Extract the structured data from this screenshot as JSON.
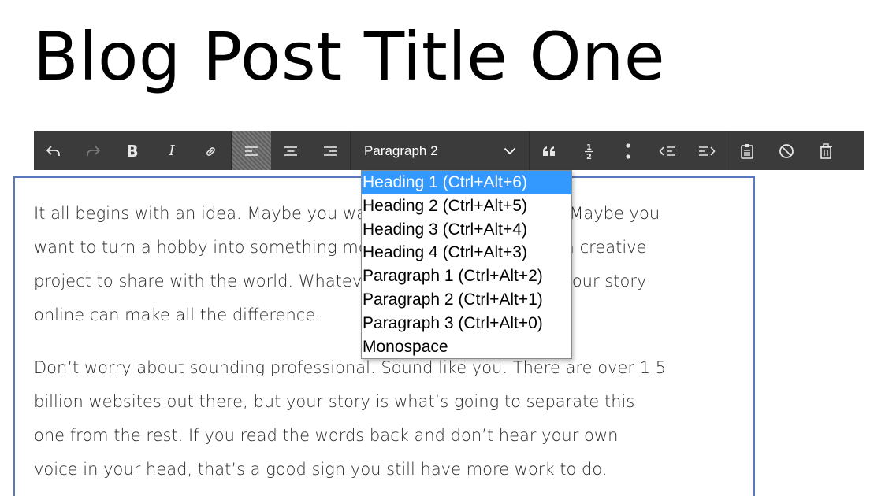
{
  "post": {
    "title": "Blog Post Title One"
  },
  "toolbar": {
    "format_value": "Paragraph 2",
    "buttons": {
      "undo": "undo-icon",
      "redo": "redo-icon",
      "bold": "B",
      "italic": "I",
      "link": "link-icon",
      "align_left": "align-left-icon",
      "align_center": "align-center-icon",
      "align_right": "align-right-icon",
      "quote": "quote-icon",
      "numbered_list": "numbered-list-icon",
      "bulleted_list": "bulleted-list-icon",
      "outdent": "outdent-icon",
      "indent": "indent-icon",
      "paste": "clipboard-icon",
      "clear_format": "clear-format-icon",
      "delete": "trash-icon"
    }
  },
  "format_dropdown": {
    "options": [
      "Heading 1 (Ctrl+Alt+6)",
      "Heading 2 (Ctrl+Alt+5)",
      "Heading 3 (Ctrl+Alt+4)",
      "Heading 4 (Ctrl+Alt+3)",
      "Paragraph 1 (Ctrl+Alt+2)",
      "Paragraph 2 (Ctrl+Alt+1)",
      "Paragraph 3 (Ctrl+Alt+0)",
      "Monospace"
    ],
    "highlighted": "Heading 1 (Ctrl+Alt+6)"
  },
  "content": {
    "paragraphs": [
      {
        "lines": [
          "It all begins with an idea. Maybe you want to launch a business. Maybe you",
          "want to turn a hobby into something more. Or maybe you have a creative",
          "project to share with the world. Whatever it is, the way you tell your story",
          "online can make all the difference."
        ]
      },
      {
        "lines": [
          "Don’t worry about sounding professional. Sound like you. There are over 1.5",
          "billion websites out there, but your story is what’s going to separate this",
          "one from the rest. If you read the words back and don’t hear your own",
          "voice in your head, that’s a good sign you still have more work to do."
        ]
      }
    ]
  },
  "colors": {
    "toolbar_bg": "#3b3b3b",
    "editor_border": "#5a78bd",
    "dropdown_highlight": "#3399ff"
  }
}
